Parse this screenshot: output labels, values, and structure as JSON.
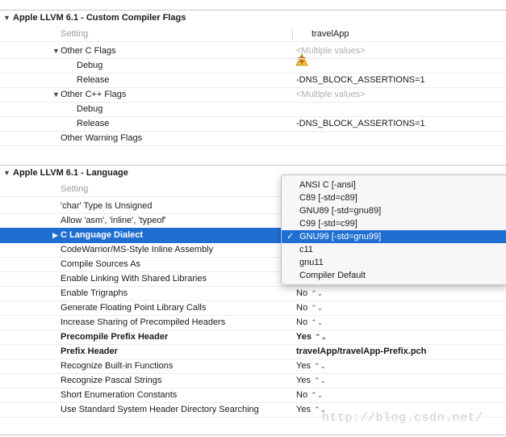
{
  "sections": {
    "custom_flags": {
      "title": "Apple LLVM 6.1 - Custom Compiler Flags",
      "setting_header": "Setting",
      "target_name": "travelApp",
      "rows": [
        {
          "label": "Other C Flags",
          "value": "<Multiple values>"
        },
        {
          "label": "Debug",
          "value": ""
        },
        {
          "label": "Release",
          "value": "-DNS_BLOCK_ASSERTIONS=1"
        },
        {
          "label": "Other C++ Flags",
          "value": "<Multiple values>"
        },
        {
          "label": "Debug",
          "value": ""
        },
        {
          "label": "Release",
          "value": "-DNS_BLOCK_ASSERTIONS=1"
        },
        {
          "label": "Other Warning Flags",
          "value": ""
        }
      ]
    },
    "language": {
      "title": "Apple LLVM 6.1 - Language",
      "setting_header": "Setting",
      "rows": [
        {
          "label": "'char' Type Is Unsigned",
          "value": ""
        },
        {
          "label": "Allow 'asm', 'inline', 'typeof'",
          "value": ""
        },
        {
          "label": "C Language Dialect",
          "value": ""
        },
        {
          "label": "CodeWarrior/MS-Style Inline Assembly",
          "value": ""
        },
        {
          "label": "Compile Sources As",
          "value": ""
        },
        {
          "label": "Enable Linking With Shared Libraries",
          "value": ""
        },
        {
          "label": "Enable Trigraphs",
          "value": "No"
        },
        {
          "label": "Generate Floating Point Library Calls",
          "value": "No"
        },
        {
          "label": "Increase Sharing of Precompiled Headers",
          "value": "No"
        },
        {
          "label": "Precompile Prefix Header",
          "value": "Yes"
        },
        {
          "label": "Prefix Header",
          "value": "travelApp/travelApp-Prefix.pch"
        },
        {
          "label": "Recognize Built-in Functions",
          "value": "Yes"
        },
        {
          "label": "Recognize Pascal Strings",
          "value": "Yes"
        },
        {
          "label": "Short Enumeration Constants",
          "value": "No"
        },
        {
          "label": "Use Standard System Header Directory Searching",
          "value": "Yes"
        }
      ]
    }
  },
  "dialect_menu": {
    "options": [
      "ANSI C [-ansi]",
      "C89 [-std=c89]",
      "GNU89 [-std=gnu89]",
      "C99 [-std=c99]",
      "GNU99 [-std=gnu99]",
      "c11",
      "gnu11",
      "Compiler Default"
    ],
    "selected": "GNU99 [-std=gnu99]",
    "check_mark": "✓"
  },
  "watermark": "http://blog.csdn.net/",
  "colors": {
    "selection": "#1f6fd3",
    "muted": "#b0b0b0"
  }
}
